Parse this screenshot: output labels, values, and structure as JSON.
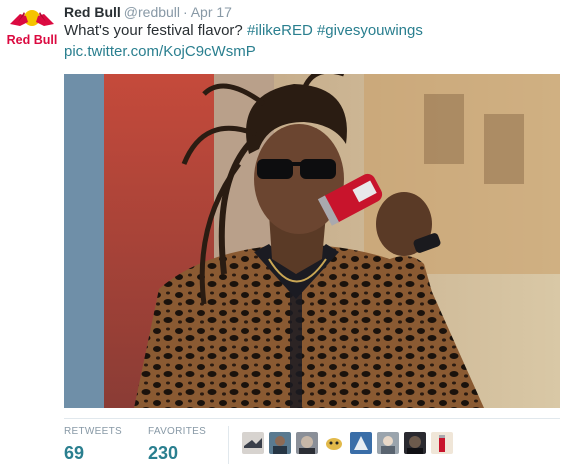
{
  "tweet": {
    "author_name": "Red Bull",
    "handle": "@redbull",
    "separator": "·",
    "date": "Apr 17",
    "text_prefix": "What's your festival flavor?",
    "hashtag_1": "#ilikeRED",
    "hashtag_2": "#givesyouwings",
    "pic_link": "pic.twitter.com/KojC9cWsmP"
  },
  "avatar": {
    "logo_text": "Red Bull",
    "icon": "red-bull-logo"
  },
  "stats": {
    "retweets_label": "RETWEETS",
    "retweets_value": "69",
    "favorites_label": "FAVORITES",
    "favorites_value": "230"
  },
  "favoriters": [
    {
      "icon": "user-avatar"
    },
    {
      "icon": "user-avatar"
    },
    {
      "icon": "user-avatar"
    },
    {
      "icon": "user-avatar"
    },
    {
      "icon": "user-avatar"
    },
    {
      "icon": "user-avatar"
    },
    {
      "icon": "user-avatar"
    },
    {
      "icon": "user-avatar"
    }
  ],
  "colors": {
    "link": "#2a7f8f",
    "muted": "#8899a6",
    "text": "#292f33",
    "brand_red": "#db0a40",
    "brand_yellow": "#f5c300"
  }
}
